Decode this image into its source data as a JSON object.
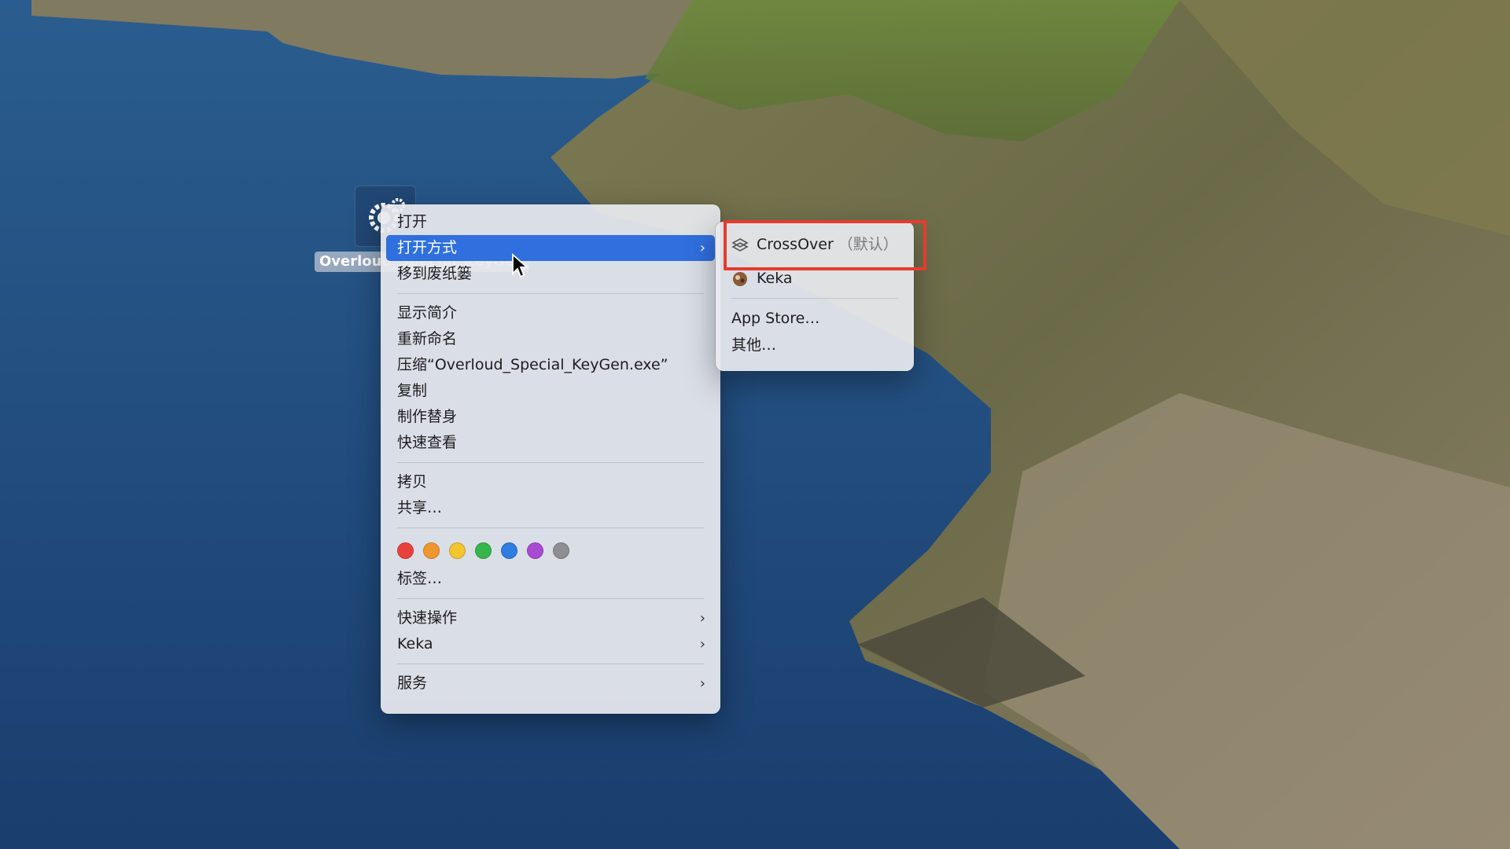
{
  "desktop": {
    "file_icon_name": "gear-exe-icon",
    "file_label": "Overloud_Special_KeyGen"
  },
  "context_menu": {
    "items_top": [
      {
        "label": "打开",
        "submenu": false,
        "active": false
      },
      {
        "label": "打开方式",
        "submenu": true,
        "active": true
      },
      {
        "label": "移到废纸篓",
        "submenu": false,
        "active": false
      }
    ],
    "items_info": [
      {
        "label": "显示简介"
      },
      {
        "label": "重新命名"
      },
      {
        "label": "压缩“Overloud_Special_KeyGen.exe”"
      },
      {
        "label": "复制"
      },
      {
        "label": "制作替身"
      },
      {
        "label": "快速查看"
      }
    ],
    "items_share": [
      {
        "label": "拷贝"
      },
      {
        "label": "共享…"
      }
    ],
    "tag_colors": [
      "#e9423c",
      "#f0962e",
      "#f2c531",
      "#35b64b",
      "#2f7de0",
      "#a94bd2",
      "#8e8e93"
    ],
    "tags_label": "标签…",
    "items_actions": [
      {
        "label": "快速操作"
      },
      {
        "label": "Keka"
      }
    ],
    "services_label": "服务",
    "chevron": "›"
  },
  "open_with_submenu": {
    "apps": [
      {
        "name": "CrossOver",
        "suffix": "（默认）",
        "icon": "crossover-icon"
      },
      {
        "name": "Keka",
        "suffix": "",
        "icon": "keka-icon"
      }
    ],
    "app_store_label": "App Store…",
    "other_label": "其他…"
  },
  "annotation": {
    "color": "#e63b2e"
  }
}
